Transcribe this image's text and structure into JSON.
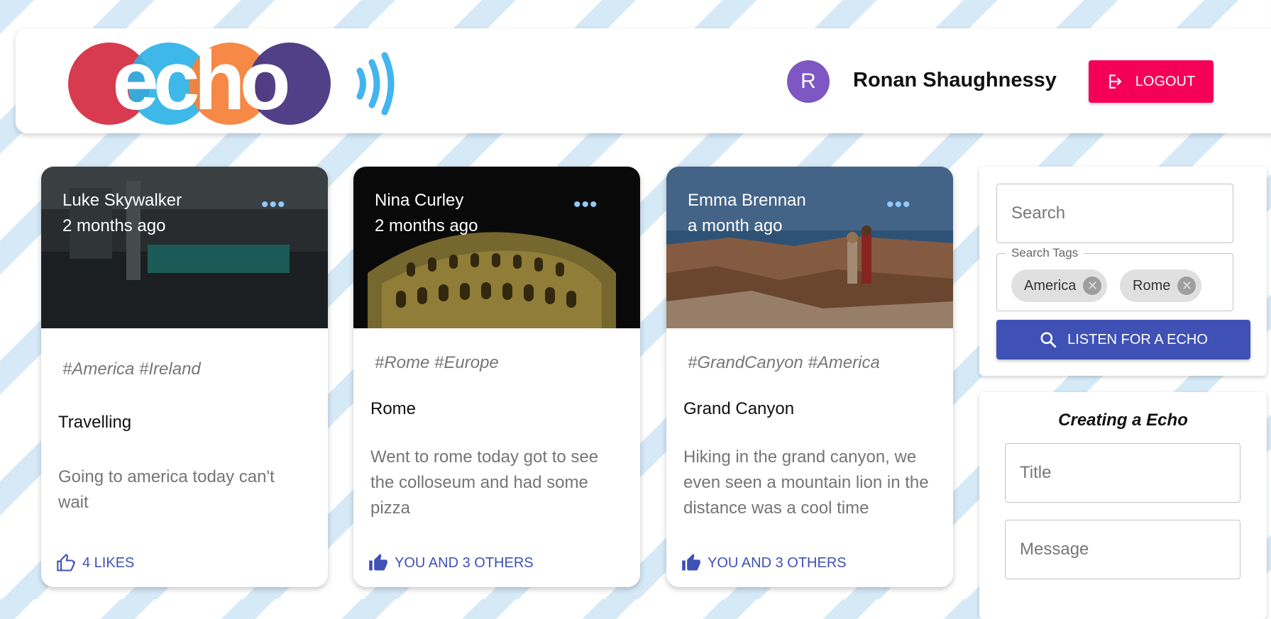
{
  "header": {
    "logo_text": "echo",
    "user": {
      "avatar_initial": "R",
      "name": "Ronan Shaughnessy"
    },
    "logout_label": "LOGOUT"
  },
  "cards": [
    {
      "author": "Luke Skywalker",
      "time": "2 months ago",
      "tags": "#America #Ireland",
      "title": "Travelling",
      "message": "Going to america today can't wait",
      "likes": "4 LIKES"
    },
    {
      "author": "Nina Curley",
      "time": "2 months ago",
      "tags": "#Rome #Europe",
      "title": "Rome",
      "message": "Went to rome today got to see the colloseum and had some pizza",
      "likes": "YOU AND 3 OTHERS"
    },
    {
      "author": "Emma Brennan",
      "time": "a month ago",
      "tags": "#GrandCanyon #America",
      "title": "Grand Canyon",
      "message": "Hiking in the grand canyon, we even seen a mountain lion in the distance was a cool time",
      "likes": "YOU AND 3 OTHERS"
    }
  ],
  "search_panel": {
    "search_placeholder": "Search",
    "tags_label": "Search Tags",
    "chips": [
      "America",
      "Rome"
    ],
    "listen_label": "LISTEN FOR A ECHO"
  },
  "create_panel": {
    "heading": "Creating a Echo",
    "title_placeholder": "Title",
    "message_placeholder": "Message"
  },
  "colors": {
    "accent": "#3f51b5",
    "logout": "#f50057",
    "avatar": "#7e57c2"
  },
  "icons": {
    "logout": "logout-icon",
    "search": "search-icon",
    "like": "thumb-up-icon",
    "remove_chip": "cancel-icon",
    "more": "more-horiz-icon"
  }
}
